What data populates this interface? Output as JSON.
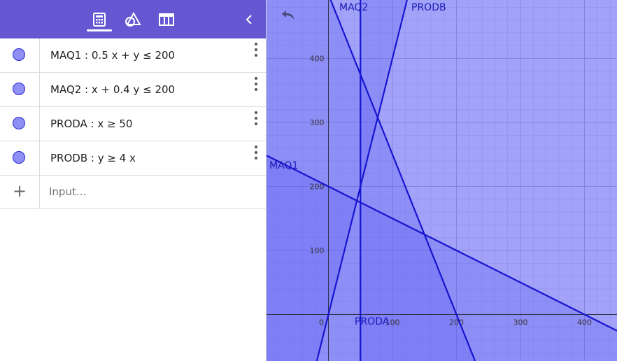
{
  "toolbar": {
    "tabs": [
      {
        "name": "algebra",
        "icon": "calculator-icon",
        "active": true
      },
      {
        "name": "tools",
        "icon": "shapes-icon",
        "active": false
      },
      {
        "name": "table",
        "icon": "table-icon",
        "active": false
      }
    ],
    "collapse_icon": "chevron-left-icon",
    "color": "#6557d2"
  },
  "algebra": {
    "rows": [
      {
        "label": "MAQ1 :  0.5 x + y ≤ 200"
      },
      {
        "label": "MAQ2 :  x + 0.4 y ≤ 200"
      },
      {
        "label": "PRODA :  x ≥ 50"
      },
      {
        "label": "PRODB :  y ≥ 4 x"
      }
    ],
    "input_placeholder": "Input..."
  },
  "graph": {
    "undo_icon": "undo-icon",
    "x_ticks": [
      "0",
      "100",
      "200",
      "300",
      "400"
    ],
    "y_ticks": [
      "100",
      "200",
      "300",
      "400"
    ],
    "line_labels": {
      "maq1": "MAQ1",
      "maq2": "MAQ2",
      "proda": "PRODA",
      "prodb": "PRODB"
    },
    "line_color": "#1515d0"
  }
}
